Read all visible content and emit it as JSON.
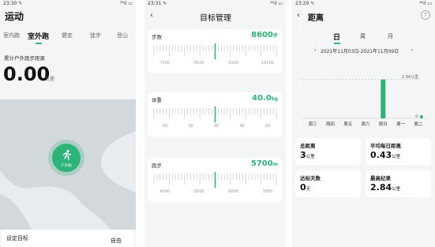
{
  "colors": {
    "accent": "#2db37a",
    "bg": "#f4f5f7"
  },
  "screen1": {
    "status_time": "23:30 ✎",
    "status_right": "⁴⁶ıl ▭",
    "title": "运动",
    "tabs": [
      "室内跑",
      "室外跑",
      "健走",
      "徒步",
      "登山"
    ],
    "active_tab": "室外跑",
    "distance_label": "累计户外跑步距离",
    "distance_value": "0.00",
    "distance_unit": "公里",
    "start_button_icon": "running-person-icon",
    "start_button_label": "户外跑",
    "goal_label": "设定目标",
    "goal_sub": "",
    "goal_value": "自由"
  },
  "screen2": {
    "status_time": "23:31 ✎",
    "status_right": "⁴⁶ıl ▭",
    "back": "‹",
    "title": "目标管理",
    "cards": [
      {
        "label": "步数",
        "value": "8600",
        "unit": "步",
        "ticks": [
          "7100",
          "8100",
          "9100",
          "10100"
        ],
        "indicator": 0.5
      },
      {
        "label": "体重",
        "value": "40.0",
        "unit": "kg",
        "ticks": [
          "20",
          "30",
          "40",
          "45",
          "50"
        ],
        "indicator": 0.5
      },
      {
        "label": "跑步",
        "value": "5700",
        "unit": "m",
        "ticks": [
          "4000",
          "5000",
          "6000",
          "7000"
        ],
        "indicator": 0.5
      }
    ]
  },
  "screen3": {
    "status_time": "23:29 ✎",
    "status_right": "⁴⁶ıl ▭",
    "back": "‹",
    "title": "距离",
    "help_icon": "help-circle-icon",
    "period_tabs": [
      "日",
      "周",
      "月"
    ],
    "active_period": "日",
    "date_range": "2021年11月03日-2021年11月09日",
    "prev": "‹",
    "next": "›",
    "stats": [
      {
        "label": "总距离",
        "value": "3",
        "unit": "公里"
      },
      {
        "label": "平均每日距离",
        "value": "0.43",
        "unit": "公里"
      },
      {
        "label": "达标天数",
        "value": "0",
        "unit": "天"
      },
      {
        "label": "最高纪录",
        "value": "2.84",
        "unit": "公里"
      }
    ]
  },
  "chart_data": {
    "type": "bar",
    "categories": [
      "周三",
      "周四",
      "周五",
      "周六",
      "周日",
      "周一",
      "周二"
    ],
    "values": [
      0,
      0,
      0,
      0,
      2.84,
      0,
      0
    ],
    "max_label": "2.84公里",
    "ylim": [
      0,
      3
    ],
    "title": "",
    "xlabel": "",
    "ylabel": ""
  }
}
